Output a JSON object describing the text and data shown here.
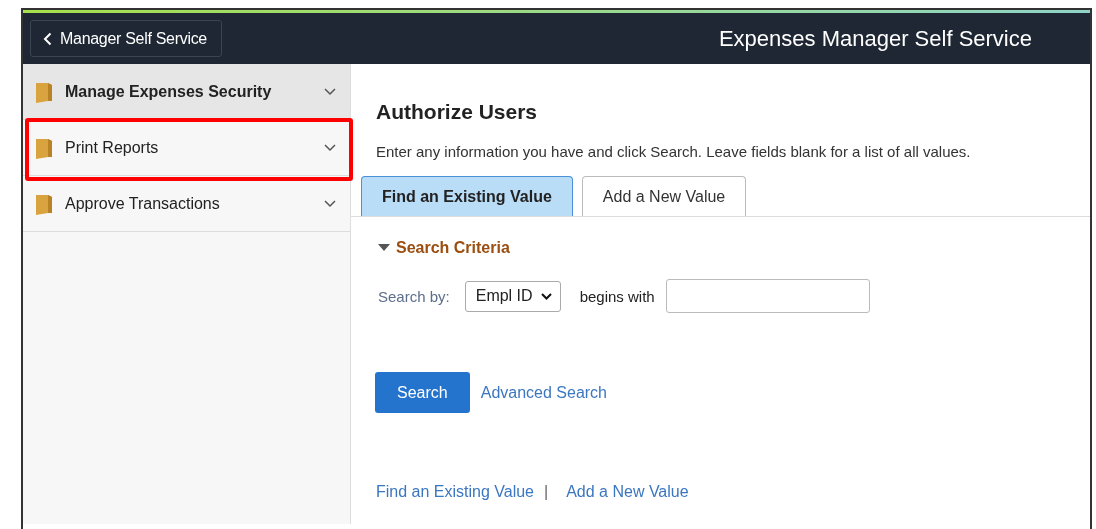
{
  "header": {
    "back_button": "Manager Self Service",
    "title": "Expenses Manager Self Service"
  },
  "sidebar": {
    "items": [
      {
        "label": "Manage Expenses Security",
        "selected": true,
        "highlighted": false
      },
      {
        "label": "Print Reports",
        "selected": false,
        "highlighted": true
      },
      {
        "label": "Approve Transactions",
        "selected": false,
        "highlighted": false
      }
    ]
  },
  "page": {
    "title": "Authorize Users",
    "instructions": "Enter any information you have and click Search. Leave fields blank for a list of all values.",
    "tabs": [
      {
        "label": "Find an Existing Value",
        "selected": true
      },
      {
        "label": "Add a New Value",
        "selected": false
      }
    ],
    "section": {
      "title": "Search Criteria",
      "expanded": true
    },
    "search_by_label": "Search by:",
    "search_by_value": "Empl ID",
    "operator": "begins with",
    "search_button": "Search",
    "advanced_link": "Advanced Search",
    "footer_links": [
      "Find an Existing Value",
      "Add a New Value"
    ],
    "footer_separator": "|"
  }
}
